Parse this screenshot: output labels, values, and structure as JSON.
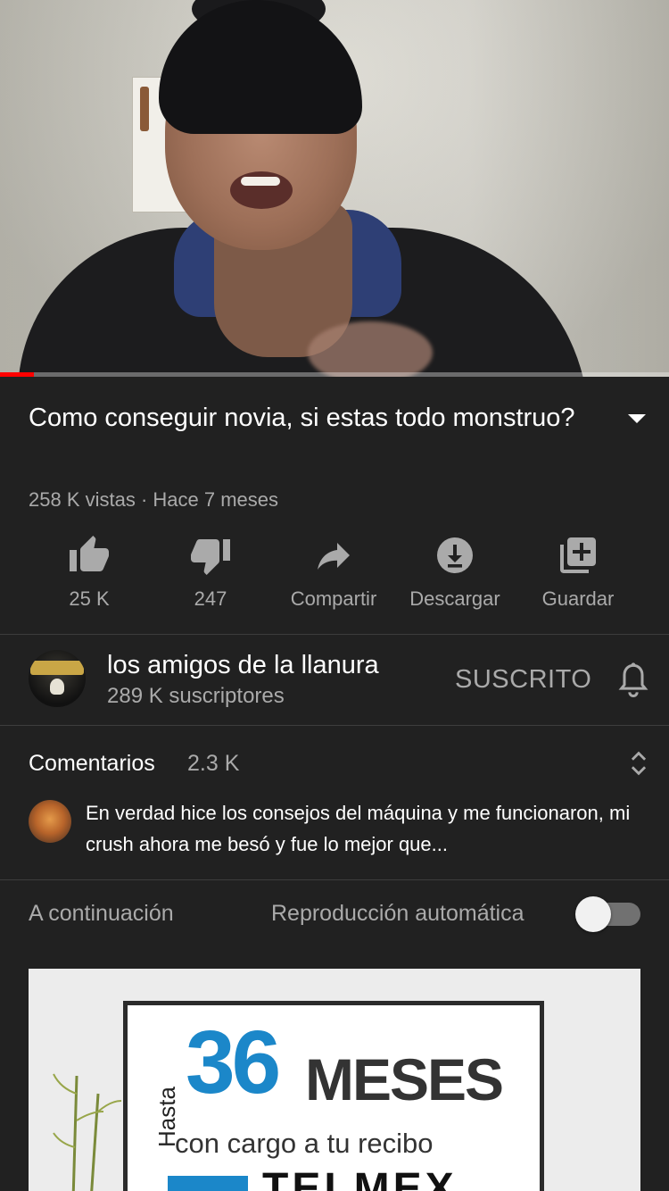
{
  "player": {
    "progress_fraction": 0.05
  },
  "video": {
    "title": "Como conseguir novia, si estas todo monstruo?",
    "meta": "258 K vistas · Hace 7 meses"
  },
  "actions": {
    "like": "25 K",
    "dislike": "247",
    "share": "Compartir",
    "download": "Descargar",
    "save": "Guardar"
  },
  "channel": {
    "name": "los amigos de la llanura",
    "subscribers": "289 K suscriptores",
    "subscribed_label": "SUSCRITO"
  },
  "comments": {
    "title": "Comentarios",
    "count": "2.3 K",
    "top_comment": "En verdad hice los consejos del máquina y me funcionaron, mi crush ahora me besó y fue lo mejor que..."
  },
  "up_next": {
    "label": "A continuación",
    "autoplay_label": "Reproducción automática",
    "autoplay_on": false
  },
  "ad": {
    "hasta": "Hasta",
    "number": "36",
    "meses": "MESES",
    "cargo": "con cargo a tu recibo",
    "brand": "TELMEX"
  },
  "colors": {
    "background": "#212121",
    "progress": "#ff0000",
    "secondary_text": "#aaaaaa",
    "accent_blue": "#1b87c9"
  }
}
